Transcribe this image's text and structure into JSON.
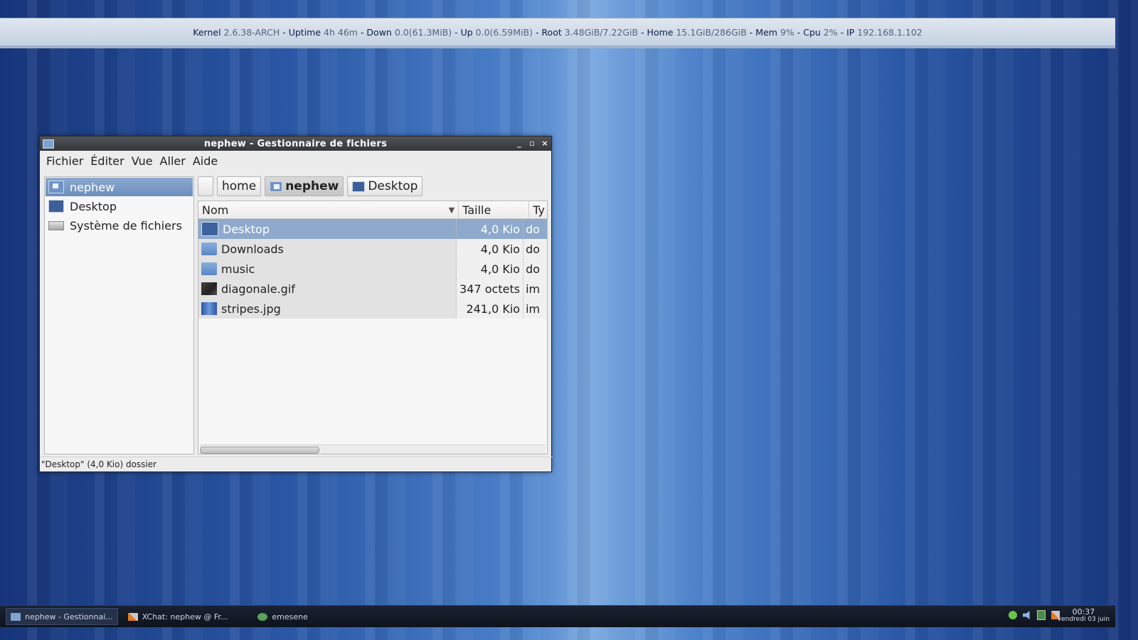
{
  "conky": {
    "kernel_k": "Kernel ",
    "kernel_v": "2.6.38-ARCH",
    "uptime_k": " - Uptime ",
    "uptime_v": "4h 46m",
    "down_k": " - Down ",
    "down_v": "0.0(61.3MiB)",
    "up_k": " - Up ",
    "up_v": "0.0(6.59MiB)",
    "root_k": " - Root ",
    "root_v": "3.48GiB/7.22GiB",
    "home_k": " - Home ",
    "home_v": "15.1GiB/286GiB",
    "mem_k": " - Mem ",
    "mem_v": "9%",
    "cpu_k": " - Cpu ",
    "cpu_v": "2%",
    "ip_k": " - IP ",
    "ip_v": "192.168.1.102"
  },
  "window": {
    "title": "nephew - Gestionnaire de fichiers",
    "controls": {
      "minimize": "_",
      "maximize": "▫",
      "close": "×"
    }
  },
  "menubar": [
    "Fichier",
    "Éditer",
    "Vue",
    "Aller",
    "Aide"
  ],
  "sidebar": {
    "items": [
      {
        "label": "nephew",
        "icon": "home-folder-icon",
        "active": true
      },
      {
        "label": "Desktop",
        "icon": "desktop-icon",
        "active": false
      },
      {
        "label": "Système de fichiers",
        "icon": "drive-icon",
        "active": false
      }
    ]
  },
  "pathbar": {
    "buttons": [
      "home",
      "nephew",
      "Desktop"
    ],
    "active": "nephew"
  },
  "filelist": {
    "columns": {
      "name": "Nom",
      "size": "Taille",
      "type": "Ty"
    },
    "sort_arrow": "▼",
    "rows": [
      {
        "name": "Desktop",
        "size": "4,0 Kio",
        "type": "do",
        "icon": "desktop-folder-icon",
        "selected": true
      },
      {
        "name": "Downloads",
        "size": "4,0 Kio",
        "type": "do",
        "icon": "folder-icon",
        "selected": false
      },
      {
        "name": "music",
        "size": "4,0 Kio",
        "type": "do",
        "icon": "folder-icon",
        "selected": false
      },
      {
        "name": "diagonale.gif",
        "size": "347 octets",
        "type": "im",
        "icon": "gif-thumbnail-icon",
        "selected": false
      },
      {
        "name": "stripes.jpg",
        "size": "241,0 Kio",
        "type": "im",
        "icon": "jpg-thumbnail-icon",
        "selected": false
      }
    ]
  },
  "statusbar": "\"Desktop\" (4,0 Kio) dossier",
  "taskbar": {
    "tasks": [
      {
        "label": "nephew - Gestionnai...",
        "active": true
      },
      {
        "label": "XChat: nephew @ Fr...",
        "active": false
      },
      {
        "label": "emesene",
        "active": false
      }
    ],
    "clock_time": "00:37",
    "clock_date": "vendredi 03 juin"
  }
}
